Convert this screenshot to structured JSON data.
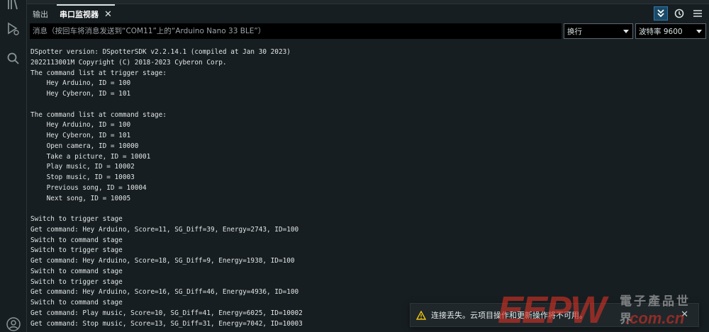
{
  "tabs": [
    {
      "label": "输出"
    },
    {
      "label": "串口监视器"
    }
  ],
  "close_glyph": "✕",
  "message": {
    "placeholder": "消息（按回车将消息发送到“COM11”上的“Arduino Nano 33 BLE”）",
    "value": ""
  },
  "line_ending": {
    "selected": "换行"
  },
  "baud_rate": {
    "selected": "波特率 9600"
  },
  "icons": {
    "activity": [
      "library-icon",
      "debug-run-icon",
      "search-icon",
      "account-icon"
    ],
    "tools": [
      "autoscroll-icon",
      "timestamp-icon",
      "more-menu-icon"
    ]
  },
  "output_lines": [
    "DSpotter version: DSpotterSDK v2.2.14.1 (compiled at Jan 30 2023)",
    "2022113001M Copyright (C) 2018-2023 Cyberon Corp.",
    "The command list at trigger stage:",
    "    Hey Arduino, ID = 100",
    "    Hey Cyberon, ID = 101",
    "",
    "The command list at command stage:",
    "    Hey Arduino, ID = 100",
    "    Hey Cyberon, ID = 101",
    "    Open camera, ID = 10000",
    "    Take a picture, ID = 10001",
    "    Play music, ID = 10002",
    "    Stop music, ID = 10003",
    "    Previous song, ID = 10004",
    "    Next song, ID = 10005",
    "",
    "Switch to trigger stage",
    "Get command: Hey Arduino, Score=11, SG_Diff=39, Energy=2743, ID=100",
    "Switch to command stage",
    "Switch to trigger stage",
    "Get command: Hey Arduino, Score=18, SG_Diff=9, Energy=1938, ID=100",
    "Switch to command stage",
    "Switch to trigger stage",
    "Get command: Hey Arduino, Score=16, SG_Diff=46, Energy=4936, ID=100",
    "Switch to command stage",
    "Get command: Play music, Score=10, SG_Diff=41, Energy=6025, ID=10002",
    "Get command: Stop music, Score=13, SG_Diff=31, Energy=7042, ID=10003"
  ],
  "toast": {
    "icon": "warning-icon",
    "text": "连接丢失。云项目操作和更新操作将不可用。"
  },
  "watermark": {
    "logo": "EEPW",
    "tagline": "電子產品世界",
    "url": ".com.cn"
  },
  "colors": {
    "background": "#171e21",
    "accent": "#2f7ab2",
    "warning": "#f1c40f",
    "watermark_red": "#d63024"
  }
}
